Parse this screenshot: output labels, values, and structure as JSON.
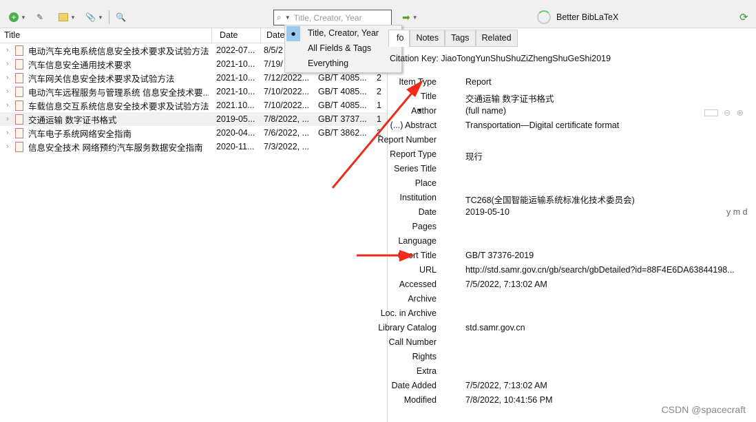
{
  "toolbar": {
    "search_placeholder": "Title, Creator, Year",
    "sync_label": "Better BibLaTeX"
  },
  "search_menu": {
    "items": [
      {
        "label": "Title, Creator, Year",
        "checked": true
      },
      {
        "label": "All Fields & Tags"
      },
      {
        "label": "Everything"
      }
    ]
  },
  "columns": [
    "Title",
    "Date",
    "Date"
  ],
  "rows": [
    {
      "title": "电动汽车充电系统信息安全技术要求及试验方法",
      "date": "2022-07...",
      "added": "8/5/2",
      "short": "",
      "count": ""
    },
    {
      "title": "汽车信息安全通用技术要求",
      "date": "2021-10...",
      "added": "7/19/",
      "short": "",
      "count": ""
    },
    {
      "title": "汽车网关信息安全技术要求及试验方法",
      "date": "2021-10...",
      "added": "7/12/2022...",
      "short": "GB/T 4085...",
      "count": "2"
    },
    {
      "title": "电动汽车远程服务与管理系统 信息安全技术要...",
      "date": "2021-10...",
      "added": "7/10/2022...",
      "short": "GB/T 4085...",
      "count": "2"
    },
    {
      "title": "车载信息交互系统信息安全技术要求及试验方法",
      "date": "2021.10...",
      "added": "7/10/2022...",
      "short": "GB/T 4085...",
      "count": "1"
    },
    {
      "title": "交通运输 数字证书格式",
      "date": "2019-05...",
      "added": "7/8/2022, ...",
      "short": "GB/T 3737...",
      "count": "1",
      "selected": true
    },
    {
      "title": "汽车电子系统网络安全指南",
      "date": "2020-04...",
      "added": "7/6/2022, ...",
      "short": "GB/T 3862...",
      "count": "2"
    },
    {
      "title": "信息安全技术 网络预约汽车服务数据安全指南",
      "date": "2020-11...",
      "added": "7/3/2022, ...",
      "short": "",
      "count": ""
    }
  ],
  "tabs": [
    "fo",
    "Notes",
    "Tags",
    "Related"
  ],
  "citation_key": "Citation Key: JiaoTongYunShuShuZiZhengShuGeShi2019",
  "fields": [
    {
      "label": "Item Type",
      "value": "Report"
    },
    {
      "label": "Title",
      "value": "交通运输 数字证书格式"
    },
    {
      "label": "Author",
      "value": "(full name)"
    },
    {
      "label": "(...) Abstract",
      "value": "Transportation—Digital certificate format"
    },
    {
      "label": "Report Number",
      "value": ""
    },
    {
      "label": "Report Type",
      "value": "现行"
    },
    {
      "label": "Series Title",
      "value": ""
    },
    {
      "label": "Place",
      "value": ""
    },
    {
      "label": "Institution",
      "value": "TC268(全国智能运输系统标准化技术委员会)"
    },
    {
      "label": "Date",
      "value": "2019-05-10"
    },
    {
      "label": "Pages",
      "value": ""
    },
    {
      "label": "Language",
      "value": ""
    },
    {
      "label": "Short Title",
      "value": "GB/T 37376-2019"
    },
    {
      "label": "URL",
      "value": "http://std.samr.gov.cn/gb/search/gbDetailed?id=88F4E6DA63844198..."
    },
    {
      "label": "Accessed",
      "value": "7/5/2022, 7:13:02 AM"
    },
    {
      "label": "Archive",
      "value": ""
    },
    {
      "label": "Loc. in Archive",
      "value": ""
    },
    {
      "label": "Library Catalog",
      "value": "std.samr.gov.cn"
    },
    {
      "label": "Call Number",
      "value": ""
    },
    {
      "label": "Rights",
      "value": ""
    },
    {
      "label": "Extra",
      "value": ""
    },
    {
      "label": "Date Added",
      "value": "7/5/2022, 7:13:02 AM"
    },
    {
      "label": "Modified",
      "value": "7/8/2022, 10:41:56 PM"
    }
  ],
  "date_format": "y m d",
  "watermark": "CSDN @spacecraft",
  "colors": {
    "annotation_arrow": "#ee2a1a",
    "menu_highlight": "#9cc9f0"
  }
}
